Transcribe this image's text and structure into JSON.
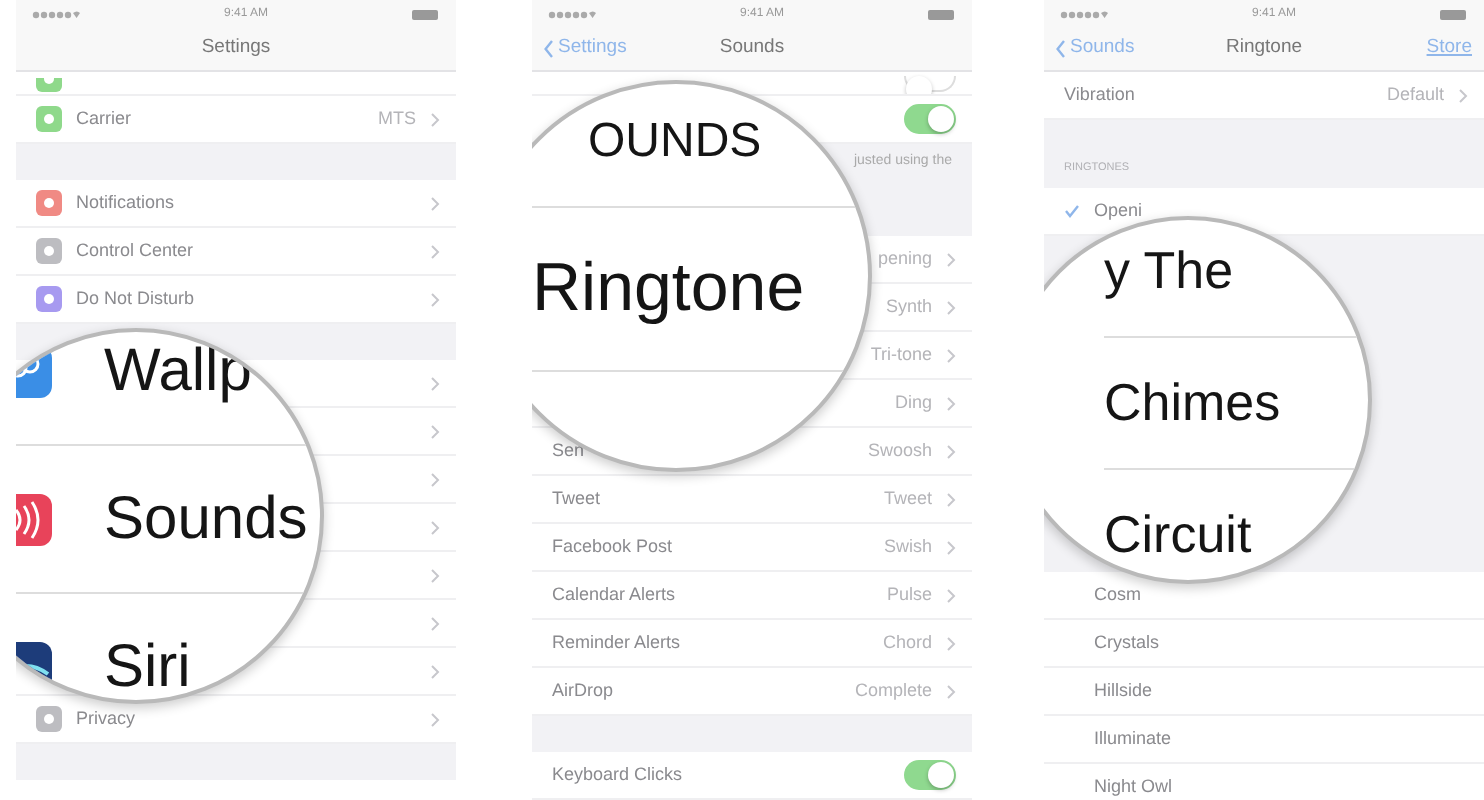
{
  "screens": [
    {
      "time": "9:41 AM",
      "title": "Settings",
      "sections": [
        {
          "rows": [
            {
              "kind": "partial",
              "color": "#8fd98b"
            },
            {
              "kind": "disclosure",
              "label": "Carrier",
              "value": "MTS",
              "color": "#8fd98b"
            }
          ]
        },
        {
          "rows": [
            {
              "kind": "disclosure",
              "label": "Notifications",
              "color": "#f08a84"
            },
            {
              "kind": "disclosure",
              "label": "Control Center",
              "color": "#bdbdc1"
            },
            {
              "kind": "disclosure",
              "label": "Do Not Disturb",
              "color": "#a79af0"
            }
          ]
        },
        {
          "rows": [
            {
              "kind": "disclosure"
            },
            {
              "kind": "disclosure"
            },
            {
              "kind": "disclosure"
            },
            {
              "kind": "disclosure"
            },
            {
              "kind": "disclosure"
            },
            {
              "kind": "disclosure"
            },
            {
              "kind": "disclosure"
            },
            {
              "kind": "disclosure",
              "label": "Privacy",
              "color": "#bdbdc1"
            }
          ]
        },
        {
          "rows": [
            {
              "kind": "partial"
            }
          ]
        }
      ],
      "magnifier": {
        "items": [
          {
            "label": "Wallp",
            "color": "#3a8ee6"
          },
          {
            "label": "Sounds",
            "color": "#e8435a"
          },
          {
            "label": "Siri",
            "color": "#1d3c7a"
          }
        ]
      }
    },
    {
      "time": "9:41 AM",
      "back": "Settings",
      "title": "Sounds",
      "sections": [
        {
          "rows": [
            {
              "kind": "partial",
              "on": false
            },
            {
              "kind": "toggle",
              "on": true
            }
          ],
          "footer": "justed using the"
        },
        {
          "rows": [
            {
              "kind": "disclosure",
              "value": "pening"
            },
            {
              "kind": "disclosure",
              "value": "Synth"
            },
            {
              "kind": "disclosure",
              "value": "Tri-tone"
            },
            {
              "kind": "disclosure",
              "value": "Ding"
            },
            {
              "kind": "disclosure",
              "label": "Sen",
              "value": "Swoosh"
            },
            {
              "kind": "disclosure",
              "label": "Tweet",
              "value": "Tweet"
            },
            {
              "kind": "disclosure",
              "label": "Facebook Post",
              "value": "Swish"
            },
            {
              "kind": "disclosure",
              "label": "Calendar Alerts",
              "value": "Pulse"
            },
            {
              "kind": "disclosure",
              "label": "Reminder Alerts",
              "value": "Chord"
            },
            {
              "kind": "disclosure",
              "label": "AirDrop",
              "value": "Complete"
            }
          ]
        },
        {
          "rows": [
            {
              "kind": "toggle",
              "label": "Keyboard Clicks",
              "on": true
            }
          ]
        }
      ],
      "magnifier": {
        "items": [
          {
            "label": "OUNDS"
          },
          {
            "label": "Ringtone"
          }
        ]
      }
    },
    {
      "time": "9:41 AM",
      "back": "Sounds",
      "title": "Ringtone",
      "action": "Store",
      "sections": [
        {
          "rows": [
            {
              "kind": "disclosure",
              "label": "Vibration",
              "value": "Default"
            }
          ]
        },
        {
          "header": "RINGTONES",
          "rows": [
            {
              "kind": "check",
              "label": "Openi",
              "checked": true
            }
          ]
        },
        {
          "rows": [
            {
              "kind": "check",
              "label": "Cosm",
              "checked": false
            },
            {
              "kind": "check",
              "label": "Crystals",
              "checked": false
            },
            {
              "kind": "check",
              "label": "Hillside",
              "checked": false
            },
            {
              "kind": "check",
              "label": "Illuminate",
              "checked": false
            },
            {
              "kind": "check",
              "label": "Night Owl",
              "checked": false
            }
          ]
        }
      ],
      "magnifier": {
        "items": [
          {
            "label": "y The"
          },
          {
            "label": "Chimes"
          },
          {
            "label": "Circuit"
          }
        ]
      }
    }
  ]
}
